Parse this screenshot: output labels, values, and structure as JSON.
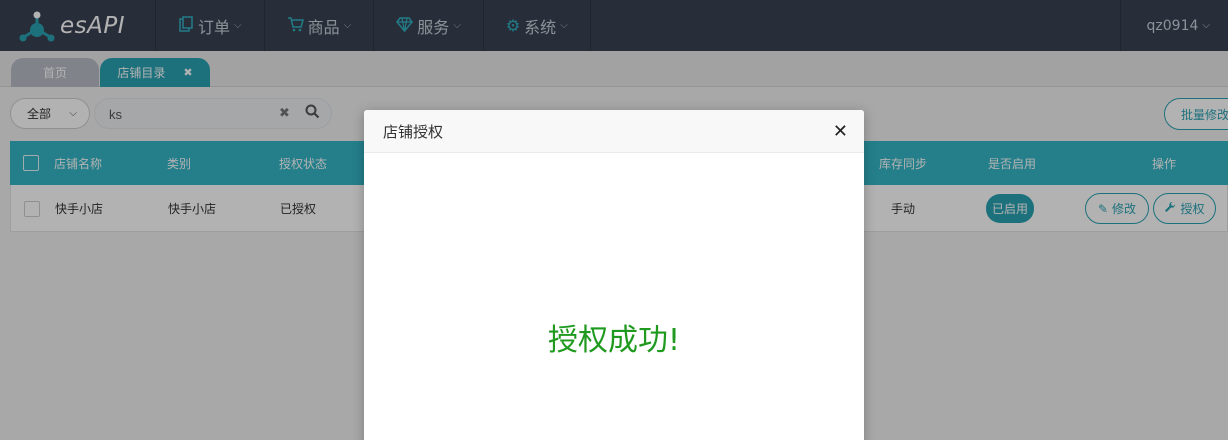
{
  "brand": {
    "name": "esAPI",
    "accent": "#2aa3b3",
    "nav_bg": "#3a4252"
  },
  "nav": [
    {
      "label": "订单",
      "icon": "clipboard-icon"
    },
    {
      "label": "商品",
      "icon": "cart-icon"
    },
    {
      "label": "服务",
      "icon": "diamond-icon"
    },
    {
      "label": "系统",
      "icon": "gear-icon"
    }
  ],
  "user": {
    "name": "qz0914"
  },
  "tabs": [
    {
      "label": "首页",
      "active": false
    },
    {
      "label": "店铺目录",
      "active": true,
      "close": "✖"
    }
  ],
  "toolbar": {
    "filter_value": "全部",
    "search_value": "ks",
    "batch_label": "批量修改"
  },
  "table": {
    "headers": [
      "店铺名称",
      "类别",
      "授权状态",
      "库存同步",
      "是否启用",
      "操作"
    ],
    "rows": [
      {
        "name": "快手小店",
        "category": "快手小店",
        "auth": "已授权",
        "sync": "手动",
        "enabled": "已启用",
        "actions": [
          "修改",
          "授权"
        ]
      }
    ]
  },
  "modal": {
    "title": "店铺授权",
    "message": "授权成功!"
  }
}
